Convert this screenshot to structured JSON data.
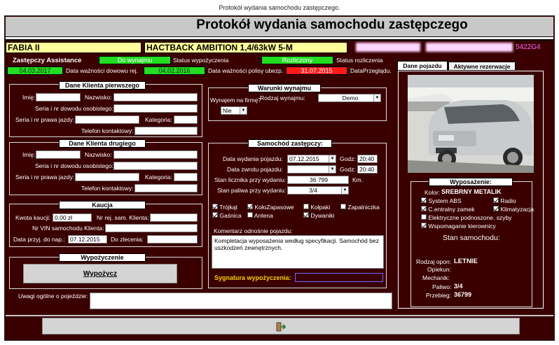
{
  "window": {
    "title": "Protokół wydania samochodu zastępczego."
  },
  "header": {
    "title": "Protokół wydania samochodu zastępczego"
  },
  "vehicle": {
    "model": "FABIA II",
    "version": "HACTBACK AMBITION 1,4/63kW 5-M",
    "code": "5422G4"
  },
  "status": {
    "assistance_label": "Zastępczy Assistance",
    "rental_value": "Do wynajmu",
    "rental_label": "Status wypożyczenia",
    "settlement_value": "Rozliczony",
    "settlement_label": "Status rozliczenia",
    "date1": "04.03.2017",
    "date1_label": "Data ważności dowowu rej.",
    "date2": "04.02.2016",
    "date2_label": "Data ważności polisy ubezp.",
    "date3": "31.07.2015",
    "date3_label": "DataPrzeglądu."
  },
  "client1": {
    "title": "Dane Klienta pierwszego",
    "first_name": "Imię:",
    "last_name": "Nazwisko:",
    "id_card": "Seria i nr dowodu osobistego:",
    "license": "Seria i nr prawa jazdy:",
    "category": "Kategoria:",
    "phone": "Telefon kontaktowy:"
  },
  "client2": {
    "title": "Dane Klienta drugiego",
    "first_name": "Imię:",
    "last_name": "Nazwisko:",
    "id_card": "Seria i nr dowodu osobistego:",
    "license": "Seria i nr prawa jazdy:",
    "category": "Kategoria:",
    "phone": "Telefon kontaktowy:"
  },
  "deposit": {
    "title": "Kaucja",
    "amount_label": "Kwota kaucji:",
    "amount": "0,00 zł",
    "reg_label": "Nr rej. sam. Klienta:",
    "vin_label": "Nr VIN samochodu Klienta:",
    "date_label": "Data przyj. do nap.:",
    "date": "07.12.2015",
    "order_label": "Do zlecenia:"
  },
  "rental": {
    "title": "Wypożyczenie",
    "button": "Wypożycz"
  },
  "notes": {
    "label": "Uwagi ogólne o pojeździe:"
  },
  "conditions": {
    "title": "Warunki wynajmu",
    "firm_label": "Wynajem na firmę?",
    "firm_value": "Nie",
    "type_label": "Rodzaj wynajmu:",
    "type_value": "Demo"
  },
  "car": {
    "title": "Samochód zastępczy:",
    "issue_label": "Data wydania pojazdu:",
    "issue_date": "07.12.2015",
    "issue_time_label": "Godz:",
    "issue_time": "20:40",
    "return_label": "Data zwrotu pojazdu:",
    "return_time_label": "Godz:",
    "return_time": "20:40",
    "odo_label": "Stan licznika przy wydaniu:",
    "odo": "36 799",
    "odo_unit": "Km.",
    "fuel_label": "Stan paliwa przy wydaniu:",
    "fuel": "3/4",
    "equipment": [
      {
        "label": "Trójkąt",
        "checked": true
      },
      {
        "label": "KołoZapasowe",
        "checked": true
      },
      {
        "label": "Kołpaki",
        "checked": false
      },
      {
        "label": "Zapalniczka",
        "checked": false
      },
      {
        "label": "Gaśnica",
        "checked": true
      },
      {
        "label": "Antena",
        "checked": false
      },
      {
        "label": "Dywaniki",
        "checked": true
      }
    ],
    "comment_label": "Komentarz odnośnie pojazdu:",
    "comment": "Kompletacja wyposażenia według specyfikacji. Samochód bez uszkodzeń zewnętrznych.",
    "signature_label": "Sygnatura wypożyczenia:"
  },
  "tabs": [
    {
      "label": "Dane pojazdu"
    },
    {
      "label": "Aktywne rezerwacje"
    }
  ],
  "equipment_panel": {
    "title": "Wyposażenie:",
    "color_label": "Kolor:",
    "color_value": "SREBRNY METALIK",
    "items": [
      {
        "label": "System ABS",
        "checked": true
      },
      {
        "label": "Radio",
        "checked": true
      },
      {
        "label": "C.entralny zamek",
        "checked": true
      },
      {
        "label": "Klimatyzacja",
        "checked": true
      },
      {
        "label": "Elektryczne podnoszone. szyby",
        "checked": false
      },
      {
        "label": "Wspomaganie  kierownicy",
        "checked": true
      }
    ],
    "state_label": "Stan samochodu:",
    "tires_label": "Rodzaj opon:",
    "tires_value": "LETNIE",
    "guardian_label": "Opiekun:",
    "mechanic_label": "Mechanik:",
    "fuel_label": "Paliwo:",
    "fuel_value": "3/4",
    "mileage_label": "Przebieg:",
    "mileage_value": "36799"
  },
  "colors": {
    "frame": "#3a0000",
    "ok": "#22dd22",
    "alert": "#ff1a1a",
    "highlight": "#ffff99"
  }
}
